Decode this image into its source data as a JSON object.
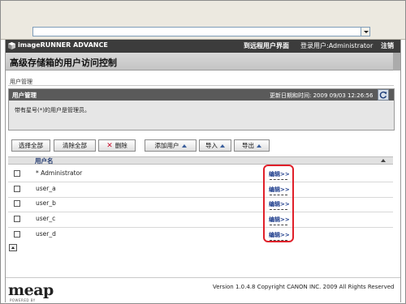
{
  "header": {
    "product": "imageRUNNER ADVANCE",
    "remote_ui_link": "到远程用户界面",
    "login_user": "登录用户:Administrator",
    "logout": "注销"
  },
  "page_title": "高级存储箱的用户访问控制",
  "breadcrumb": "用户管理",
  "panel": {
    "title": "用户管理",
    "updated": "更新日期和时间: 2009 09/03 12:26:56",
    "note": "带有星号(*)的用户是管理员。"
  },
  "toolbar": {
    "select_all": "选择全部",
    "clear_all": "清除全部",
    "delete": "删除",
    "add_user": "添加用户",
    "import": "导入",
    "export": "导出"
  },
  "table": {
    "column_header": "用户名",
    "edit_label": "编辑>>",
    "rows": [
      {
        "name": "* Administrator"
      },
      {
        "name": "user_a"
      },
      {
        "name": "user_b"
      },
      {
        "name": "user_c"
      },
      {
        "name": "user_d"
      }
    ]
  },
  "footer": {
    "logo": "meap",
    "logo_sub": "POWERED BY",
    "version": "Version 1.0.4.8 Copyright CANON INC. 2009 All Rights Reserved"
  },
  "colors": {
    "header_bg": "#3c3c3c",
    "link": "#1a3a8a",
    "highlight": "#e0202a"
  }
}
